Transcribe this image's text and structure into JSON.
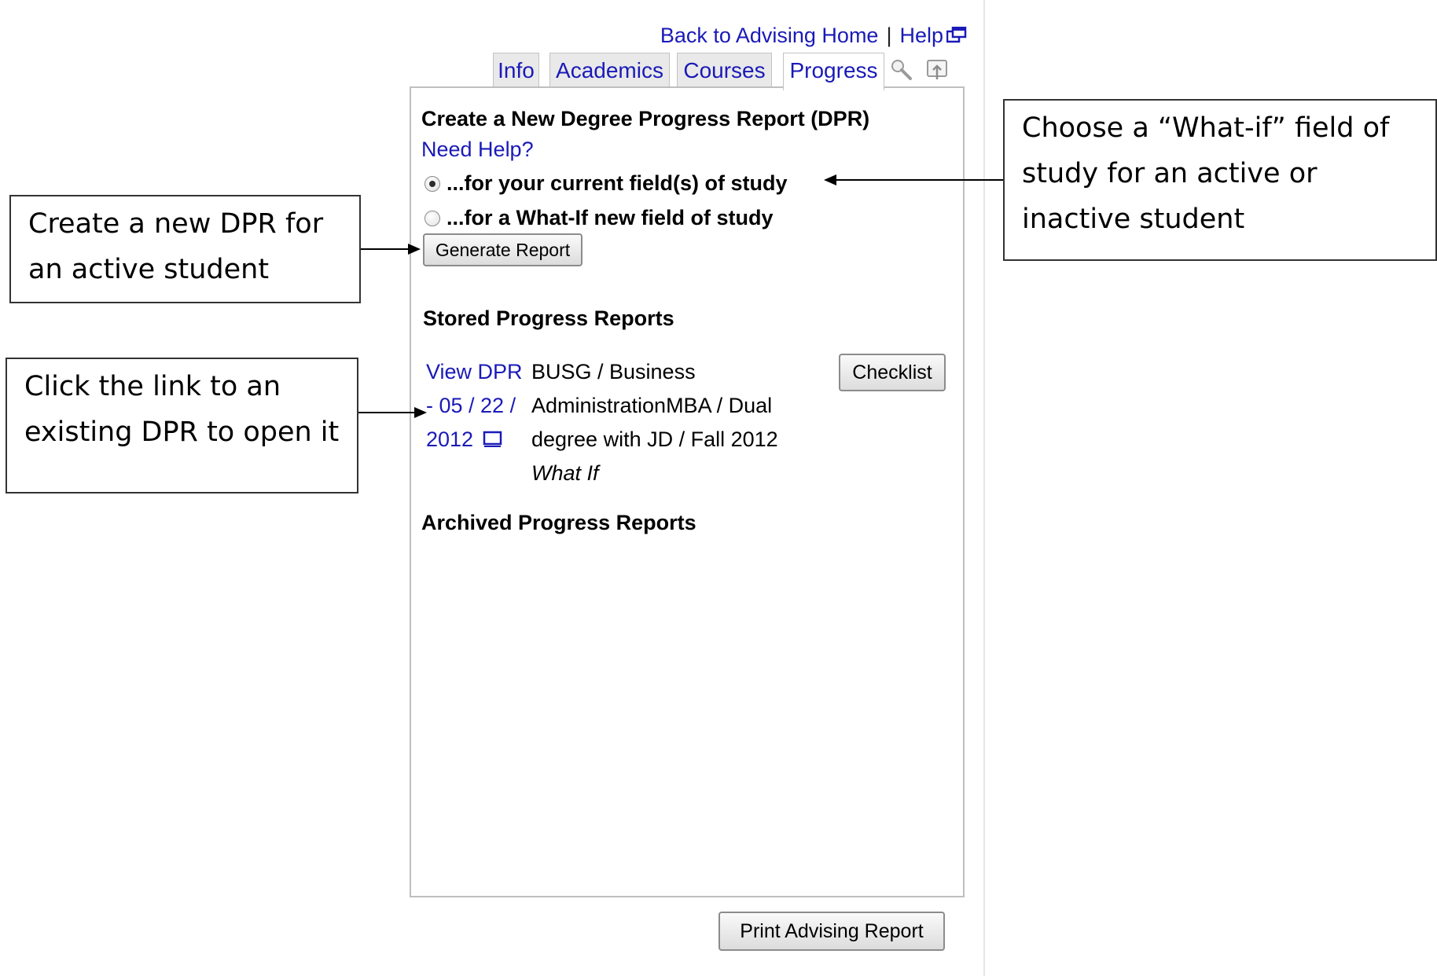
{
  "nav": {
    "back_link": "Back to Advising Home",
    "separator": "|",
    "help_link": "Help"
  },
  "tabs": [
    {
      "label": "Info",
      "active": false
    },
    {
      "label": "Academics",
      "active": false
    },
    {
      "label": "Courses",
      "active": false
    },
    {
      "label": "Progress",
      "active": true
    }
  ],
  "toolbar_icons": [
    "zoom-icon",
    "expand-icon"
  ],
  "create": {
    "heading": "Create a New Degree Progress Report (DPR)",
    "help_link": "Need Help?",
    "option_current": "...for your current field(s) of study",
    "option_whatif": "...for a What-If new field of study",
    "selected_option": "current",
    "generate_button": "Generate Report"
  },
  "stored": {
    "heading": "Stored Progress Reports",
    "reports": [
      {
        "link_lines": [
          "View DPR",
          "- 05 / 22 /",
          "2012"
        ],
        "desc_lines": [
          "BUSG / Business",
          "AdministrationMBA / Dual",
          "degree with JD / Fall 2012"
        ],
        "tag": "What If",
        "button": "Checklist"
      }
    ]
  },
  "archived": {
    "heading": "Archived Progress Reports"
  },
  "print_button": "Print Advising Report",
  "annotations": {
    "create_new": [
      "Create a new DPR for",
      "an active student"
    ],
    "click_link": [
      "Click the link to an",
      "existing DPR to open it"
    ],
    "whatif": [
      "Choose a “What-if” field of",
      "study for an active or",
      "inactive student"
    ]
  },
  "colors": {
    "link": "#1a1ab8",
    "tab_bg": "#e9e9e9",
    "panel_border": "#bfbfbf"
  }
}
